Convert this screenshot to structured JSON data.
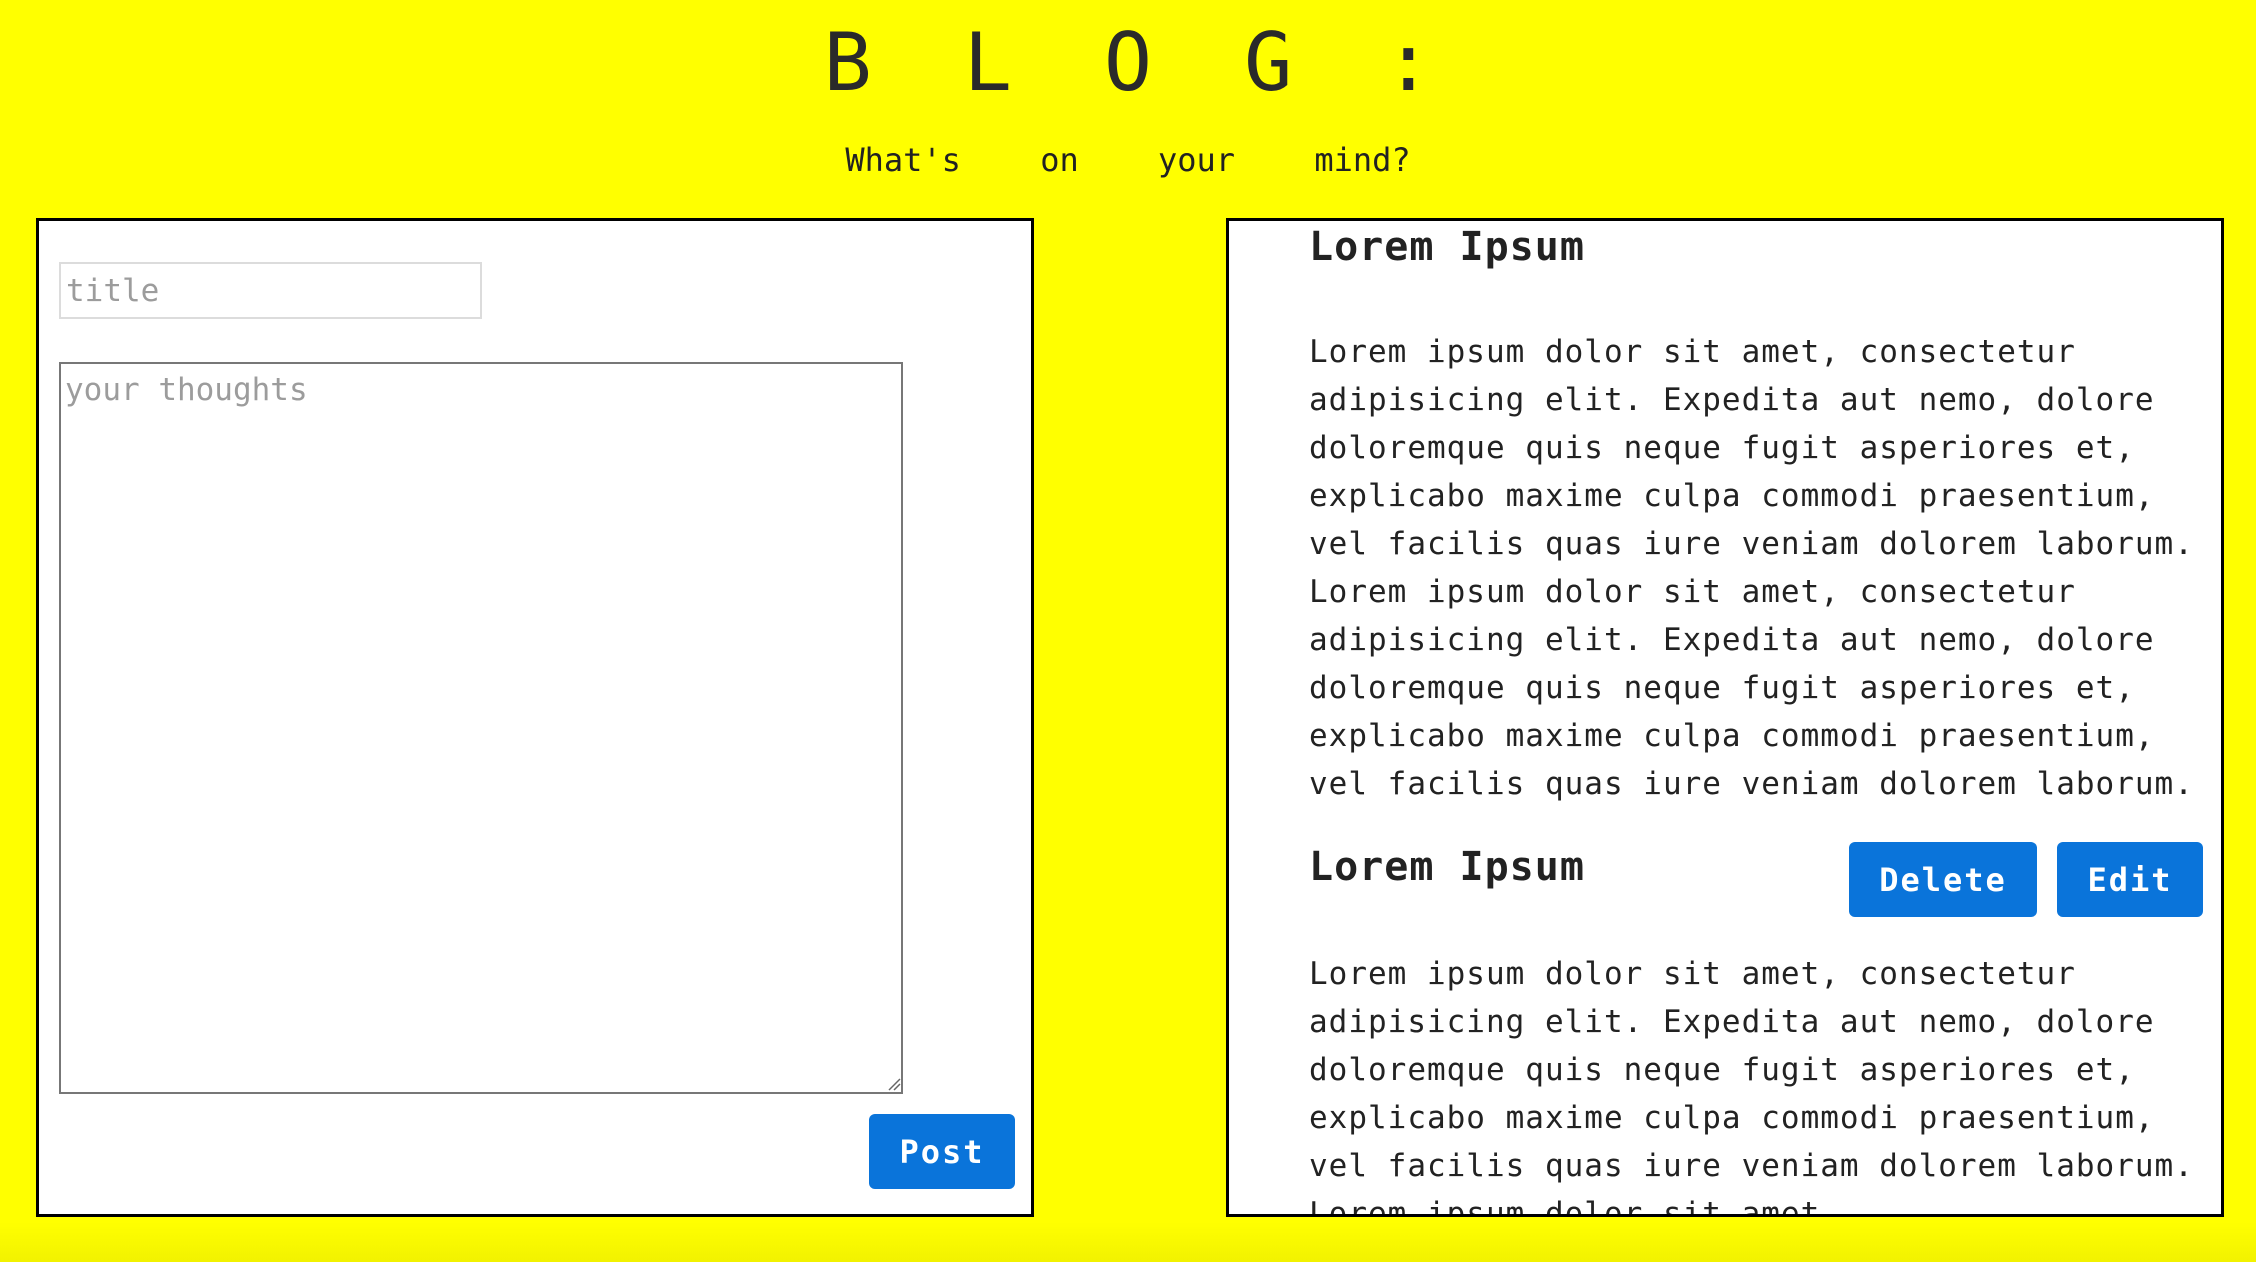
{
  "header": {
    "title": "BLOG:",
    "tagline": "What's on your mind?"
  },
  "editor": {
    "title_placeholder": "title",
    "thoughts_placeholder": "your thoughts",
    "title_value": "",
    "thoughts_value": "",
    "post_label": "Post"
  },
  "posts": [
    {
      "title": "Lorem Ipsum",
      "body": "Lorem ipsum dolor sit amet, consectetur adipisicing elit. Expedita aut nemo, dolore doloremque quis neque fugit asperiores et, explicabo maxime culpa commodi praesentium, vel facilis quas iure veniam dolorem laborum. Lorem ipsum dolor sit amet, consectetur adipisicing elit. Expedita aut nemo, dolore doloremque quis neque fugit asperiores et, explicabo maxime culpa commodi praesentium, vel facilis quas iure veniam dolorem laborum."
    },
    {
      "title": "Lorem Ipsum",
      "body": "Lorem ipsum dolor sit amet, consectetur adipisicing elit. Expedita aut nemo, dolore doloremque quis neque fugit asperiores et, explicabo maxime culpa commodi praesentium, vel facilis quas iure veniam dolorem laborum. Lorem ipsum dolor sit amet",
      "delete_label": "Delete",
      "edit_label": "Edit"
    }
  ],
  "colors": {
    "background": "#ffff00",
    "button": "#0a74da",
    "border": "#000000"
  }
}
